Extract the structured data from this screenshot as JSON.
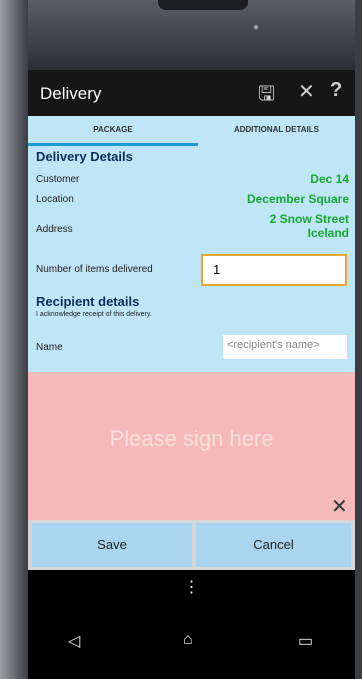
{
  "app": {
    "title": "Delivery"
  },
  "toolbar": {
    "save_icon": "floppy-disk-icon",
    "close_icon": "close-icon",
    "help_label": "?"
  },
  "tabs": [
    {
      "label": "PACKAGE",
      "selected": true
    },
    {
      "label": "ADDITIONAL DETAILS",
      "selected": false
    }
  ],
  "delivery": {
    "title": "Delivery Details",
    "customer_label": "Customer",
    "customer_value": "Dec 14",
    "location_label": "Location",
    "location_value": "December Square",
    "address_label": "Address",
    "address_line1": "2 Snow Street",
    "address_line2": "Iceland",
    "items_label": "Number of  items delivered",
    "items_value": "1"
  },
  "recipient": {
    "title": "Recipient details",
    "ack": "I acknowledge receipt of this delivery.",
    "name_label": "Name",
    "name_placeholder": "<recipient's name>"
  },
  "signature": {
    "prompt": "Please sign here",
    "clear_icon": "close-icon"
  },
  "actions": {
    "save": "Save",
    "cancel": "Cancel"
  },
  "overflow": "⋮",
  "colors": {
    "accent": "#1e9bd7",
    "value_green": "#14a82e",
    "background": "#bfe6f7",
    "signature_area": "#f5b9b9",
    "button": "#a9d5f0"
  }
}
